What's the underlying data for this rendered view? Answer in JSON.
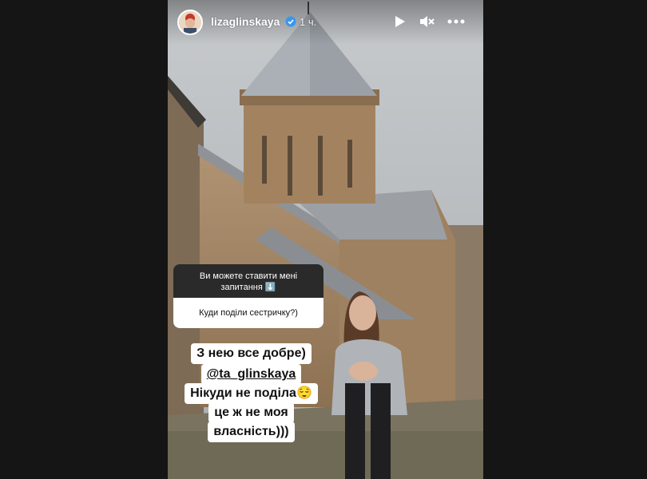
{
  "story": {
    "username": "lizaglinskaya",
    "time": "1 ч.",
    "verified": true,
    "play_icon": "play-icon",
    "mute_icon": "mute-icon",
    "more_icon": "more-icon"
  },
  "question_sticker": {
    "header": "Ви можете ставити мені запитання ⬇️",
    "question": "Куди поділи сестричку?)"
  },
  "answer_lines": [
    "З нею все добре)",
    "@ta_glinskaya",
    "Нікуди не поділа😌",
    "це ж не моя",
    "власність)))"
  ],
  "colors": {
    "background": "#151515",
    "sky": "#b9bcc0",
    "stone": "#a48866",
    "roof": "#8d9196"
  }
}
